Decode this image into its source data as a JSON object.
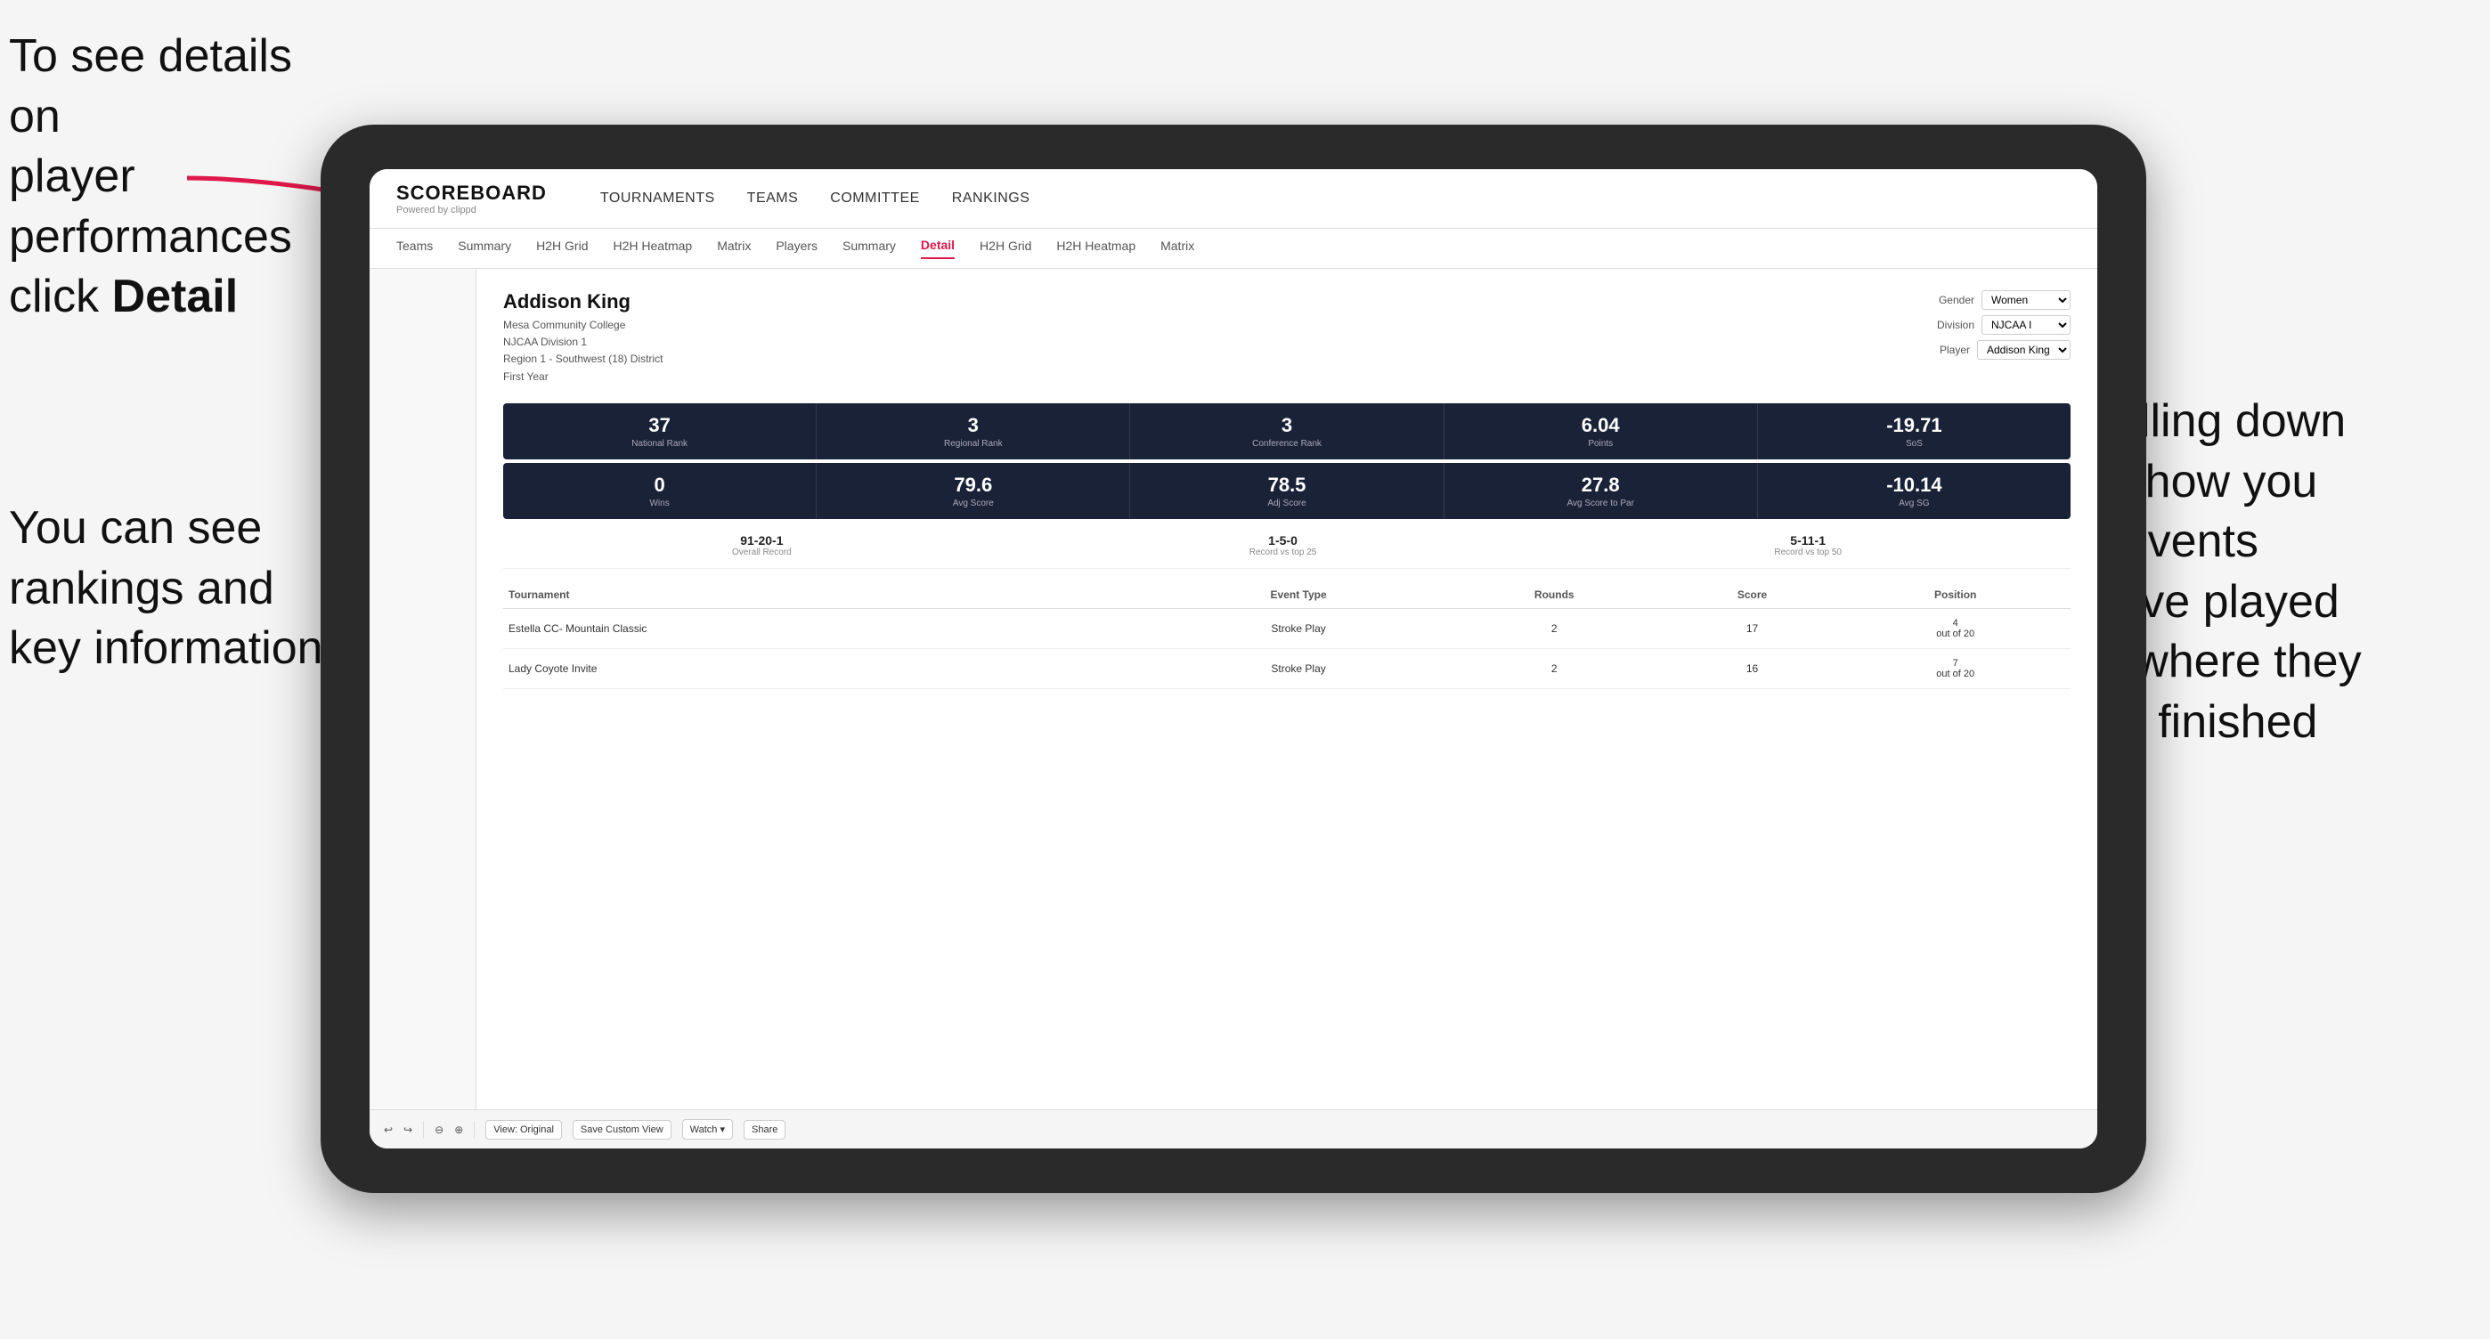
{
  "annotations": {
    "topleft": {
      "line1": "To see details on",
      "line2": "player performances",
      "line3_prefix": "click ",
      "line3_bold": "Detail"
    },
    "bottomleft": {
      "line1": "You can see",
      "line2": "rankings and",
      "line3": "key information"
    },
    "right": {
      "line1": "Scrolling down",
      "line2": "will show you",
      "line3": "the events",
      "line4": "they've played",
      "line5": "and where they",
      "line6": "have finished"
    }
  },
  "nav": {
    "logo": "SCOREBOARD",
    "logo_sub": "Powered by clippd",
    "links": [
      "TOURNAMENTS",
      "TEAMS",
      "COMMITTEE",
      "RANKINGS"
    ],
    "active_link": "COMMITTEE"
  },
  "sub_nav": {
    "tabs": [
      "Teams",
      "Summary",
      "H2H Grid",
      "H2H Heatmap",
      "Matrix",
      "Players",
      "Summary",
      "Detail",
      "H2H Grid",
      "H2H Heatmap",
      "Matrix"
    ],
    "active_tab": "Detail"
  },
  "player": {
    "name": "Addison King",
    "school": "Mesa Community College",
    "division": "NJCAA Division 1",
    "region": "Region 1 - Southwest (18) District",
    "year": "First Year"
  },
  "filters": {
    "gender_label": "Gender",
    "gender_value": "Women",
    "division_label": "Division",
    "division_value": "NJCAA I",
    "player_label": "Player",
    "player_value": "Addison King"
  },
  "stats_row1": [
    {
      "value": "37",
      "label": "National Rank"
    },
    {
      "value": "3",
      "label": "Regional Rank"
    },
    {
      "value": "3",
      "label": "Conference Rank"
    },
    {
      "value": "6.04",
      "label": "Points"
    },
    {
      "value": "-19.71",
      "label": "SoS"
    }
  ],
  "stats_row2": [
    {
      "value": "0",
      "label": "Wins"
    },
    {
      "value": "79.6",
      "label": "Avg Score"
    },
    {
      "value": "78.5",
      "label": "Adj Score"
    },
    {
      "value": "27.8",
      "label": "Avg Score to Par"
    },
    {
      "value": "-10.14",
      "label": "Avg SG"
    }
  ],
  "records": [
    {
      "value": "91-20-1",
      "label": "Overall Record"
    },
    {
      "value": "1-5-0",
      "label": "Record vs top 25"
    },
    {
      "value": "5-11-1",
      "label": "Record vs top 50"
    }
  ],
  "table": {
    "headers": [
      "Tournament",
      "Event Type",
      "Rounds",
      "Score",
      "Position"
    ],
    "rows": [
      {
        "tournament": "Estella CC- Mountain Classic",
        "event_type": "Stroke Play",
        "rounds": "2",
        "score": "17",
        "position": "4\nout of 20"
      },
      {
        "tournament": "Lady Coyote Invite",
        "event_type": "Stroke Play",
        "rounds": "2",
        "score": "16",
        "position": "7\nout of 20"
      }
    ]
  },
  "toolbar": {
    "buttons": [
      "View: Original",
      "Save Custom View",
      "Watch ▾",
      "Share"
    ]
  }
}
